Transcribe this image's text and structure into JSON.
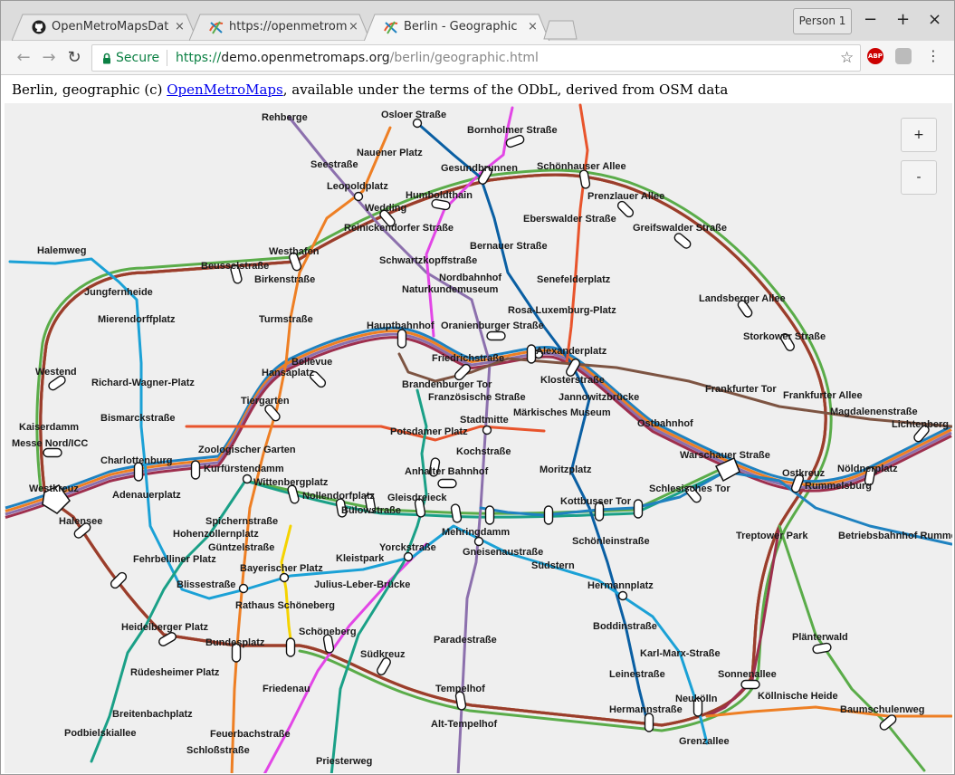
{
  "tabs": [
    {
      "title": "OpenMetroMapsData",
      "icon": "github-icon",
      "active": false
    },
    {
      "title": "https://openmetromaps",
      "icon": "metro-favicon-icon",
      "active": false
    },
    {
      "title": "Berlin - Geographic",
      "icon": "metro-favicon-icon",
      "active": true
    }
  ],
  "tab_close_glyph": "×",
  "person_button": "Person 1",
  "window_controls": {
    "minimize": "−",
    "maximize": "+",
    "close": "×"
  },
  "nav": {
    "back": "←",
    "forward": "→",
    "reload": "↻"
  },
  "address_bar": {
    "secure_label": "Secure",
    "scheme": "https://",
    "host": "demo.openmetromaps.org",
    "path": "/berlin/geographic.html"
  },
  "extensions": {
    "abp": "ABP",
    "menu": "⋮"
  },
  "attribution": {
    "prefix": "Berlin, geographic (c) ",
    "link": "OpenMetroMaps",
    "suffix": ", available under the terms of the ODbL, derived from OSM data"
  },
  "zoom": {
    "in": "+",
    "out": "-"
  },
  "line_colors": {
    "ringbahn": [
      "#b9602f",
      "#d88a3a",
      "#9a3d2d"
    ],
    "blue": "#1f82c0",
    "green": "#5aac49",
    "orange": "#ee7f24",
    "purple": "#8c70ad",
    "magenta": "#e246e6",
    "red": "#e8542c",
    "darkblue": "#0a5fa3",
    "teal": "#1aa087",
    "yellow": "#f5d300",
    "brown": "#7d5442",
    "darkred": "#9e2f4e",
    "cyan": "#1ba1d6"
  },
  "stations": [
    "Rehberge",
    "Osloer Straße",
    "Bornholmer Straße",
    "Nauener Platz",
    "Seestraße",
    "Gesundbrunnen",
    "Schönhauser Allee",
    "Leopoldplatz",
    "Humboldthain",
    "Prenzlauer Allee",
    "Wedding",
    "Eberswalder Straße",
    "Greifswalder Straße",
    "Reinickendorfer Straße",
    "Bernauer Straße",
    "Halemweg",
    "Westhafen",
    "Beusselstraße",
    "Schwartzkopffstraße",
    "Birkenstraße",
    "Nordbahnhof",
    "Senefelderplatz",
    "Jungfernheide",
    "Naturkundemuseum",
    "Landsberger Allee",
    "Rosa-Luxemburg-Platz",
    "Mierendorffplatz",
    "Turmstraße",
    "Hauptbahnhof",
    "Oranienburger Straße",
    "Storkower Straße",
    "Alexanderplatz",
    "Bellevue",
    "Friedrichstraße",
    "Westend",
    "Hansaplatz",
    "Klosterstraße",
    "Richard-Wagner-Platz",
    "Brandenburger Tor",
    "Frankfurter Tor",
    "Französische Straße",
    "Jannowitzbrücke",
    "Frankfurter Allee",
    "Tiergarten",
    "Magdalenenstraße",
    "Märkisches Museum",
    "Bismarckstraße",
    "Stadtmitte",
    "Kaiserdamm",
    "Ostbahnhof",
    "Lichtenberg",
    "Potsdamer Platz",
    "Messe Nord/ICC",
    "Zoologischer Garten",
    "Kochstraße",
    "Warschauer Straße",
    "Charlottenburg",
    "Kurfürstendamm",
    "Anhalter Bahnhof",
    "Moritzplatz",
    "Nöldnerplatz",
    "Ostkreuz",
    "Wittenbergplatz",
    "Westkreuz",
    "Schlesisches Tor",
    "Adenauerplatz",
    "Nollendorfplatz",
    "Gleisdreieck",
    "Rummelsburg",
    "Kottbusser Tor",
    "Bülowstraße",
    "Mehringdamm",
    "Halensee",
    "Spichernstraße",
    "Treptower Park",
    "Betriebsbahnhof Rummelsburg",
    "Hohenzollernplatz",
    "Schönleinstraße",
    "Güntzelstraße",
    "Yorckstraße",
    "Gneisenaustraße",
    "Fehrbelliner Platz",
    "Kleistpark",
    "Südstern",
    "Bayerischer Platz",
    "Blissestraße",
    "Julius-Leber-Brücke",
    "Hermannplatz",
    "Rathaus Schöneberg",
    "Schöneberg",
    "Heidelberger Platz",
    "Boddinstraße",
    "Paradestraße",
    "Plänterwald",
    "Bundesplatz",
    "Südkreuz",
    "Karl-Marx-Straße",
    "Rüdesheimer Platz",
    "Leinestraße",
    "Sonnenallee",
    "Friedenau",
    "Tempelhof",
    "Neukölln",
    "Köllnische Heide",
    "Breitenbachplatz",
    "Hermannstraße",
    "Baumschulenweg",
    "Alt-Tempelhof",
    "Podbielskiallee",
    "Feuerbachstraße",
    "Grenzallee",
    "Schloßstraße",
    "Priesterweg"
  ]
}
